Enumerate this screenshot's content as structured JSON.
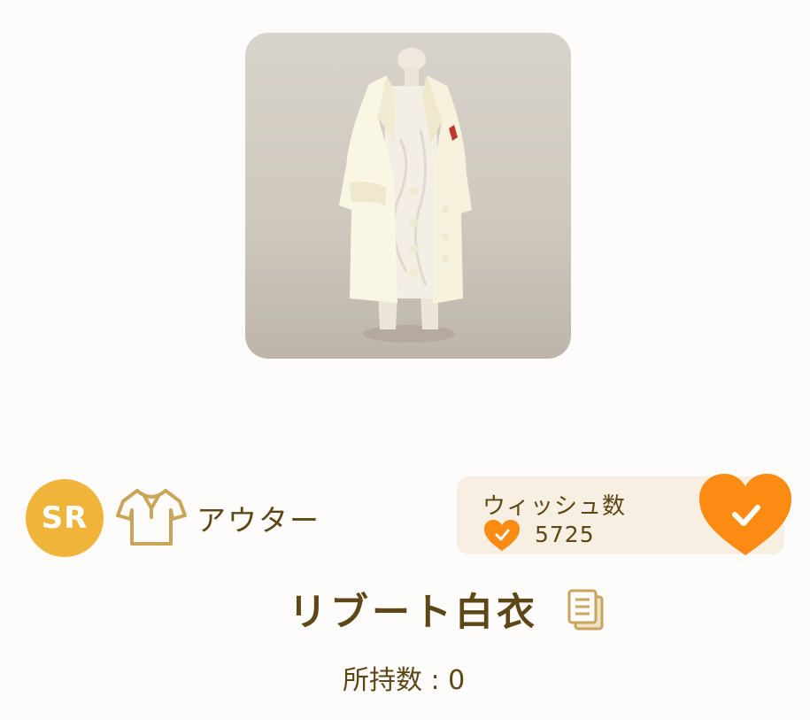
{
  "item": {
    "name": "リブート白衣",
    "image_icon": "white-coat-image"
  },
  "rarity": {
    "label": "SR",
    "color": "#f0b43a"
  },
  "category": {
    "label": "アウター",
    "icon": "shirt-icon"
  },
  "wish": {
    "title": "ウィッシュ数",
    "count": "5725",
    "button_color": "#fb8b12",
    "icon": "heart-check-icon"
  },
  "owned": {
    "label": "所持数 : 0"
  },
  "colors": {
    "text": "#5e4716",
    "panel": "#f6efe2",
    "accent": "#fb8b12"
  }
}
